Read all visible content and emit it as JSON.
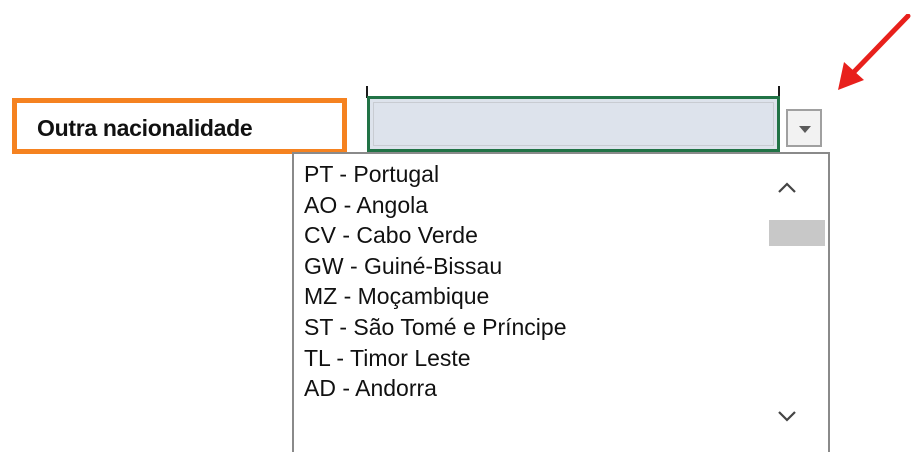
{
  "field": {
    "label": "Outra nacionalidade",
    "value": ""
  },
  "dropdown": {
    "options": [
      "PT - Portugal",
      "AO - Angola",
      "CV - Cabo Verde",
      "GW - Guiné-Bissau",
      "MZ - Moçambique",
      "ST - São Tomé e Príncipe",
      "TL - Timor Leste",
      "AD - Andorra"
    ],
    "scroll_position": 0.08
  },
  "colors": {
    "highlight_border": "#f58220",
    "active_cell_border": "#217346",
    "cell_fill": "#dde3ec",
    "annotation_arrow": "#e8201c"
  },
  "icons": {
    "dropdown_button": "chevron-down-icon",
    "scroll_up": "chevron-up-icon",
    "scroll_down": "chevron-down-icon",
    "annotation": "red-arrow-icon"
  }
}
